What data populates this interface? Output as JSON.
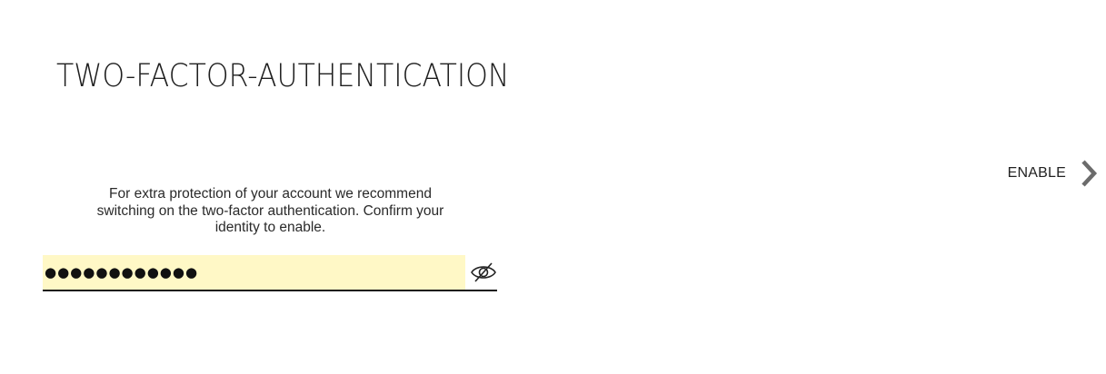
{
  "header": {
    "title": "TWO-FACTOR-AUTHENTICATION"
  },
  "action": {
    "enable_label": "ENABLE",
    "icon": "chevron-right-icon"
  },
  "description": {
    "text": "For extra protection of your account we recommend switching on the two-factor authentication. Confirm your identity to enable."
  },
  "password": {
    "value": "●●●●●●●●●●●●",
    "toggle_icon": "eye-slash-icon",
    "field_color": "#fff8c6"
  }
}
